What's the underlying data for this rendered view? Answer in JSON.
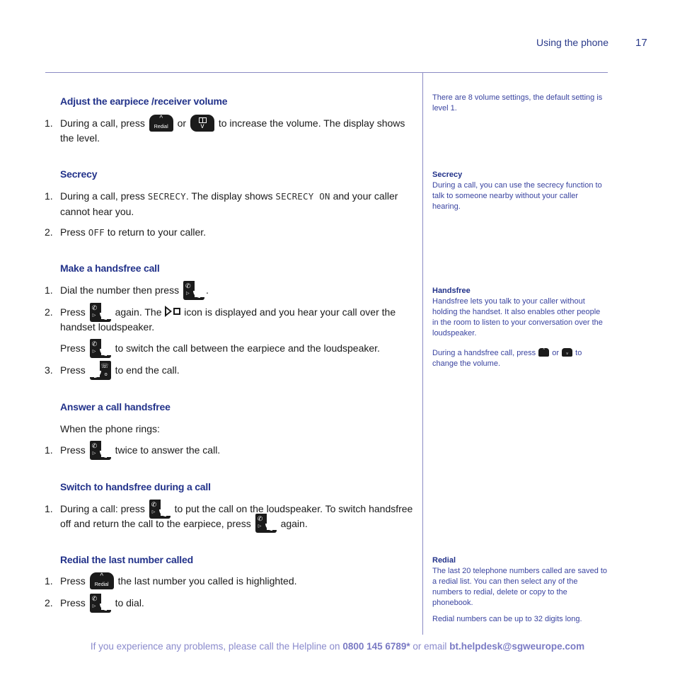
{
  "header": {
    "section_title": "Using the phone",
    "page_number": "17"
  },
  "colors": {
    "heading": "#22328a",
    "sidebar_text": "#3a44a0",
    "rule": "#8a8ac4",
    "footer": "#8a8acc"
  },
  "sections": {
    "volume": {
      "heading": "Adjust the earpiece /receiver volume",
      "step1": {
        "num": "1.",
        "pre": "During a call, press",
        "mid": "or",
        "post": "to increase the volume. The display shows the level."
      }
    },
    "secrecy": {
      "heading": "Secrecy",
      "step1": {
        "num": "1.",
        "pre": "During a call, press",
        "code1": "SECRECY",
        "mid": ". The display shows",
        "code2": "SECRECY ON",
        "post": "and your caller cannot hear you."
      },
      "step2": {
        "num": "2.",
        "pre": "Press",
        "code": "OFF",
        "post": "to return to your caller."
      }
    },
    "handsfree_call": {
      "heading": "Make a handsfree call",
      "step1": {
        "num": "1.",
        "pre": "Dial the number then press",
        "post": "."
      },
      "step2": {
        "num": "2.",
        "pre": "Press",
        "mid": "again. The",
        "post": "icon is displayed and you hear your call over the handset loudspeaker."
      },
      "step2b": {
        "pre": "Press",
        "post": "to switch the call between the earpiece and the loudspeaker."
      },
      "step3": {
        "num": "3.",
        "pre": "Press",
        "post": "to end the call."
      }
    },
    "answer_handsfree": {
      "heading": "Answer a call handsfree",
      "intro": "When the phone rings:",
      "step1": {
        "num": "1.",
        "pre": "Press",
        "post": "twice to answer the call."
      }
    },
    "switch_handsfree": {
      "heading": "Switch to handsfree during a call",
      "step1": {
        "num": "1.",
        "pre": "During a call: press",
        "mid": "to put the call on the loudspeaker. To switch handsfree off and return the call to the earpiece, press",
        "post": "again."
      }
    },
    "redial": {
      "heading": "Redial the last number called",
      "step1": {
        "num": "1.",
        "pre": "Press",
        "post": "the last number you called is highlighted."
      },
      "step2": {
        "num": "2.",
        "pre": "Press",
        "post": "to dial."
      }
    }
  },
  "keys": {
    "redial_label": "Redial",
    "chevron_up": "^",
    "chevron_down": "v",
    "phone_glyph": "✆",
    "speaker_glyph": "▷",
    "end_glyph": "☏",
    "end_dot": "o"
  },
  "sidebar": {
    "volume_note": "There are 8 volume settings, the default setting is level 1.",
    "secrecy": {
      "title": "Secrecy",
      "text": "During a call, you can use the secrecy function to talk to someone nearby without your caller hearing."
    },
    "handsfree": {
      "title": "Handsfree",
      "text": "Handsfree lets you talk to your caller without holding the handset. It also enables other people in the room to listen to your conversation over the loudspeaker.",
      "volume_pre": "During a handsfree call, press",
      "volume_mid": "or",
      "volume_post": "to change the volume."
    },
    "redial": {
      "title": "Redial",
      "text": "The last 20 telephone numbers called are saved to a redial list. You can then select any of the numbers to redial, delete or copy to the phonebook.",
      "note": "Redial numbers can be up to 32 digits long."
    }
  },
  "footer": {
    "pre": "If you experience any problems, please call the Helpline on",
    "phone": "0800 145 6789*",
    "mid": "or email",
    "email": "bt.helpdesk@sgweurope.com"
  }
}
